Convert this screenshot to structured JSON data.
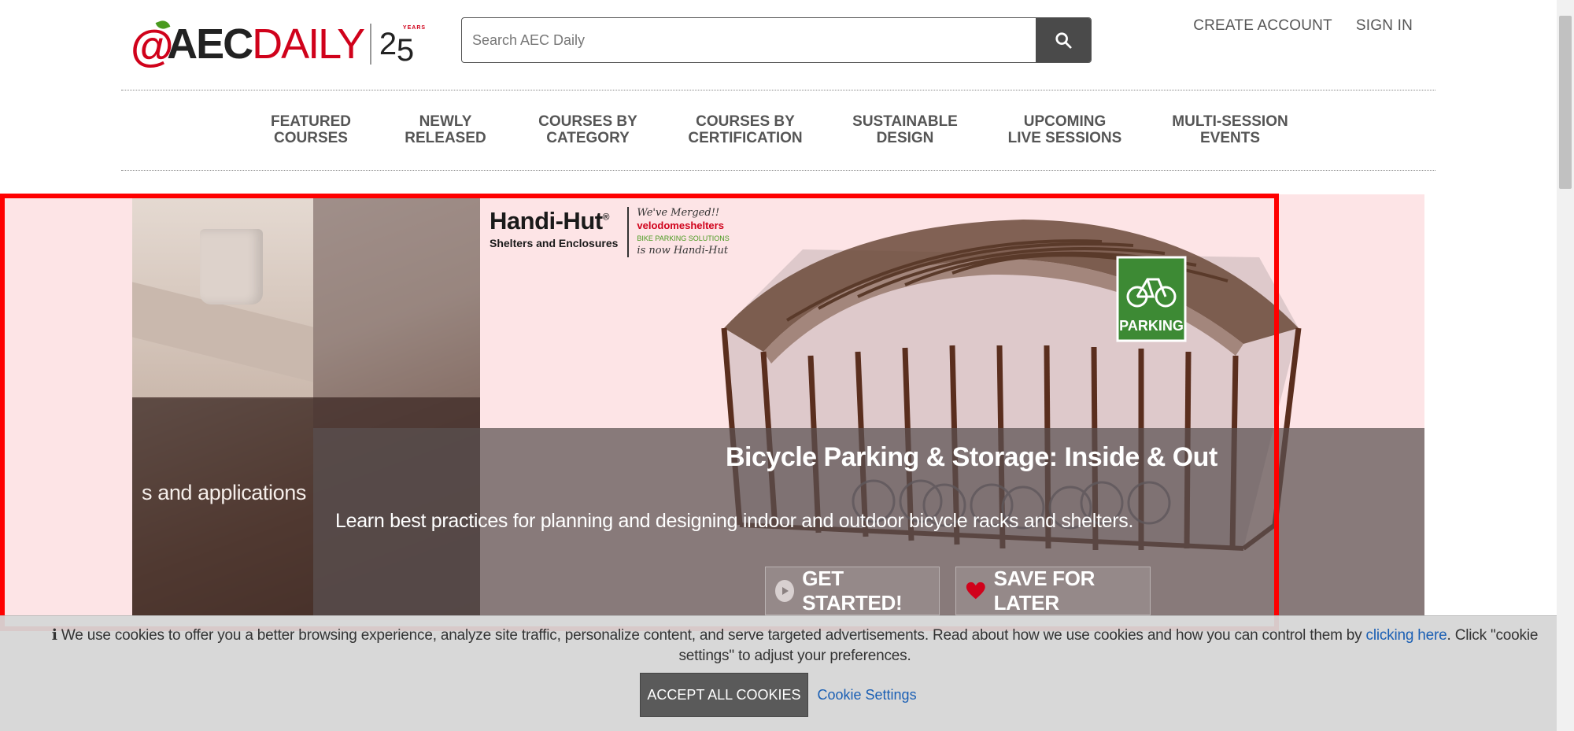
{
  "header": {
    "logo_at": "@",
    "logo_aec": "AEC",
    "logo_daily": "DAILY",
    "logo_years_2": "2",
    "logo_years_5": "5",
    "logo_years_word": "YEARS",
    "search_placeholder": "Search AEC Daily",
    "account_links": [
      "CREATE ACCOUNT",
      "SIGN IN"
    ]
  },
  "nav": {
    "items": [
      "FEATURED\nCOURSES",
      "NEWLY\nRELEASED",
      "COURSES BY\nCATEGORY",
      "COURSES BY\nCERTIFICATION",
      "SUSTAINABLE\nDESIGN",
      "UPCOMING\nLIVE SESSIONS",
      "MULTI-SESSION\nEVENTS"
    ]
  },
  "carousel": {
    "prev_snippet": "s and applications",
    "brand_name": "Handi-Hut",
    "brand_reg": "®",
    "brand_sub": "Shelters and Enclosures",
    "brand_merged": "We've Merged!!",
    "brand_velo": "velodomeshelters",
    "brand_velo_tag": "BIKE PARKING SOLUTIONS",
    "brand_now": "is now Handi-Hut",
    "sign_text": "PARKING",
    "title": "Bicycle Parking & Storage: Inside & Out",
    "description": "Learn best practices for planning and designing indoor and outdoor bicycle racks and shelters.",
    "get_started": "GET STARTED!",
    "save_later": "SAVE FOR LATER"
  },
  "cookie": {
    "text_before": "ℹ We use cookies to offer you a better browsing experience, analyze site traffic, personalize content, and serve targeted advertisements. Read about how we use cookies and how you can control them by ",
    "link_text": "clicking here",
    "text_after": ". Click \"cookie settings\" to adjust your preferences.",
    "accept_label": "ACCEPT ALL COOKIES",
    "settings_label": "Cookie Settings"
  },
  "colors": {
    "brand_red": "#d0021b",
    "link_blue": "#1a5fb4",
    "highlight_red": "#ff0000",
    "slide_pink": "#fde4e6"
  }
}
